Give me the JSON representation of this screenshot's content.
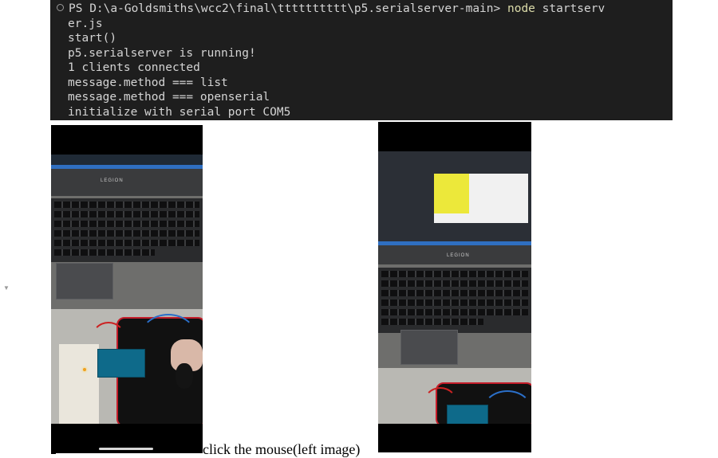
{
  "terminal": {
    "prompt": "PS D:\\a-Goldsmiths\\wcc2\\final\\tttttttttt\\p5.serialserver-main>",
    "command": "node",
    "args": "startserv",
    "lines": [
      "er.js",
      "start()",
      "p5.serialserver is running!",
      "1 clients connected",
      "message.method === list",
      "message.method === openserial",
      "initialize with serial port COM5"
    ]
  },
  "photos": {
    "left": {
      "brand": "LEGION"
    },
    "right": {
      "brand": "LEGION"
    }
  },
  "caption": "click the mouse(left image)",
  "colors": {
    "terminal_bg": "#1e1e1e",
    "terminal_text": "#d4d4d4",
    "command_highlight": "#dcdcaa",
    "sketch_yellow": "#ece83a"
  }
}
